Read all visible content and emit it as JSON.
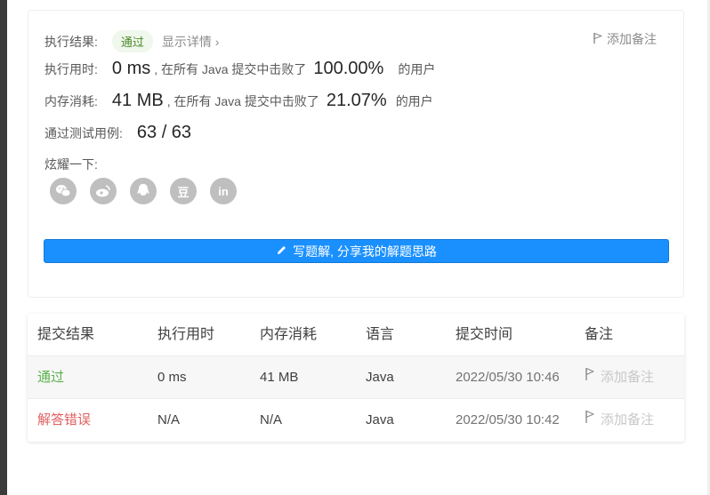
{
  "result": {
    "status_label": "执行结果:",
    "status_value": "通过",
    "details_link": "显示详情 ›",
    "add_note": "添加备注",
    "runtime": {
      "label": "执行用时:",
      "value": "0 ms",
      "pre": ", 在所有 Java 提交中击败了",
      "percent": "100.00%",
      "post": "的用户"
    },
    "memory": {
      "label": "内存消耗:",
      "value": "41 MB",
      "pre": ", 在所有 Java 提交中击败了",
      "percent": "21.07%",
      "post": "的用户"
    },
    "tests": {
      "label": "通过测试用例:",
      "value": "63 / 63"
    },
    "share_label": "炫耀一下:",
    "share_icons": [
      "wechat-icon",
      "weibo-icon",
      "qq-icon",
      "douban-icon",
      "linkedin-icon"
    ],
    "share_glyphs": {
      "douban": "豆",
      "linkedin": "in"
    },
    "solution_button": "写题解, 分享我的解题思路"
  },
  "submissions": {
    "headers": [
      "提交结果",
      "执行用时",
      "内存消耗",
      "语言",
      "提交时间",
      "备注"
    ],
    "rows": [
      {
        "result": "通过",
        "runtime": "0 ms",
        "memory": "41 MB",
        "language": "Java",
        "time": "2022/05/30 10:46",
        "note": "添加备注"
      },
      {
        "result": "解答错误",
        "runtime": "N/A",
        "memory": "N/A",
        "language": "Java",
        "time": "2022/05/30 10:42",
        "note": "添加备注"
      }
    ]
  },
  "colors": {
    "accent": "#1a90ff",
    "pass": "#5ab14b",
    "fail": "#e05f5f",
    "pill_bg": "#f0f7ec"
  }
}
